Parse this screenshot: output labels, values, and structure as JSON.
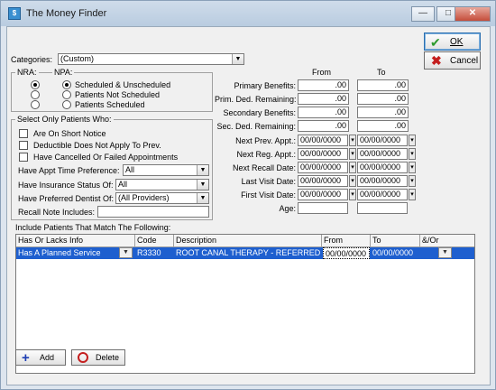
{
  "window": {
    "title": "The Money Finder",
    "icon": "money-finder-app-icon",
    "controls": [
      "minimize",
      "maximize",
      "close"
    ]
  },
  "buttons": {
    "ok": "OK",
    "cancel": "Cancel",
    "add": "Add",
    "delete": "Delete"
  },
  "categories": {
    "label": "Categories:",
    "value": "(Custom)"
  },
  "nra_npa": {
    "nra_label": "NRA:",
    "npa_label": "NPA:",
    "options": [
      "Scheduled & Unscheduled",
      "Patients Not Scheduled",
      "Patients Scheduled"
    ],
    "nra_selected": 0,
    "npa_selected": 0
  },
  "select_patients": {
    "legend": "Select Only Patients Who:",
    "checks": [
      {
        "label": "Are On Short Notice",
        "checked": false
      },
      {
        "label": "Deductible Does Not Apply To Prev.",
        "checked": false
      },
      {
        "label": "Have Cancelled Or Failed Appointments",
        "checked": false
      }
    ],
    "appt_time": {
      "label": "Have Appt Time Preference:",
      "value": "All"
    },
    "insurance": {
      "label": "Have Insurance Status Of:",
      "value": "All"
    },
    "dentist": {
      "label": "Have Preferred Dentist Of:",
      "value": "(All Providers)"
    },
    "recall_note": {
      "label": "Recall Note Includes:",
      "value": ""
    }
  },
  "ranges": {
    "from_header": "From",
    "to_header": "To",
    "money": [
      {
        "label": "Primary Benefits:",
        "from": ".00",
        "to": ".00"
      },
      {
        "label": "Prim. Ded. Remaining:",
        "from": ".00",
        "to": ".00"
      },
      {
        "label": "Secondary Benefits:",
        "from": ".00",
        "to": ".00"
      },
      {
        "label": "Sec. Ded. Remaining:",
        "from": ".00",
        "to": ".00"
      }
    ],
    "dates": [
      {
        "label": "Next Prev. Appt.:",
        "from": "00/00/0000",
        "to": "00/00/0000"
      },
      {
        "label": "Next Reg. Appt.:",
        "from": "00/00/0000",
        "to": "00/00/0000"
      },
      {
        "label": "Next Recall Date:",
        "from": "00/00/0000",
        "to": "00/00/0000"
      },
      {
        "label": "Last Visit Date:",
        "from": "00/00/0000",
        "to": "00/00/0000"
      },
      {
        "label": "First Visit Date:",
        "from": "00/00/0000",
        "to": "00/00/0000"
      }
    ],
    "age": {
      "label": "Age:",
      "from": "",
      "to": ""
    }
  },
  "include": {
    "label": "Include Patients That Match The Following:",
    "columns": [
      "Has Or Lacks Info",
      "Code",
      "Description",
      "From",
      "To",
      "&/Or"
    ],
    "rows": [
      {
        "info": "Has A Planned Service",
        "code": "R3330",
        "description": "ROOT CANAL THERAPY - REFERRED",
        "from": "00/00/0000",
        "to": "00/00/0000",
        "andor": ""
      }
    ]
  },
  "colors": {
    "selection": "#1e5fcf",
    "client_bg": "#f0f0f0",
    "title_bar": "#c4d5e8"
  }
}
